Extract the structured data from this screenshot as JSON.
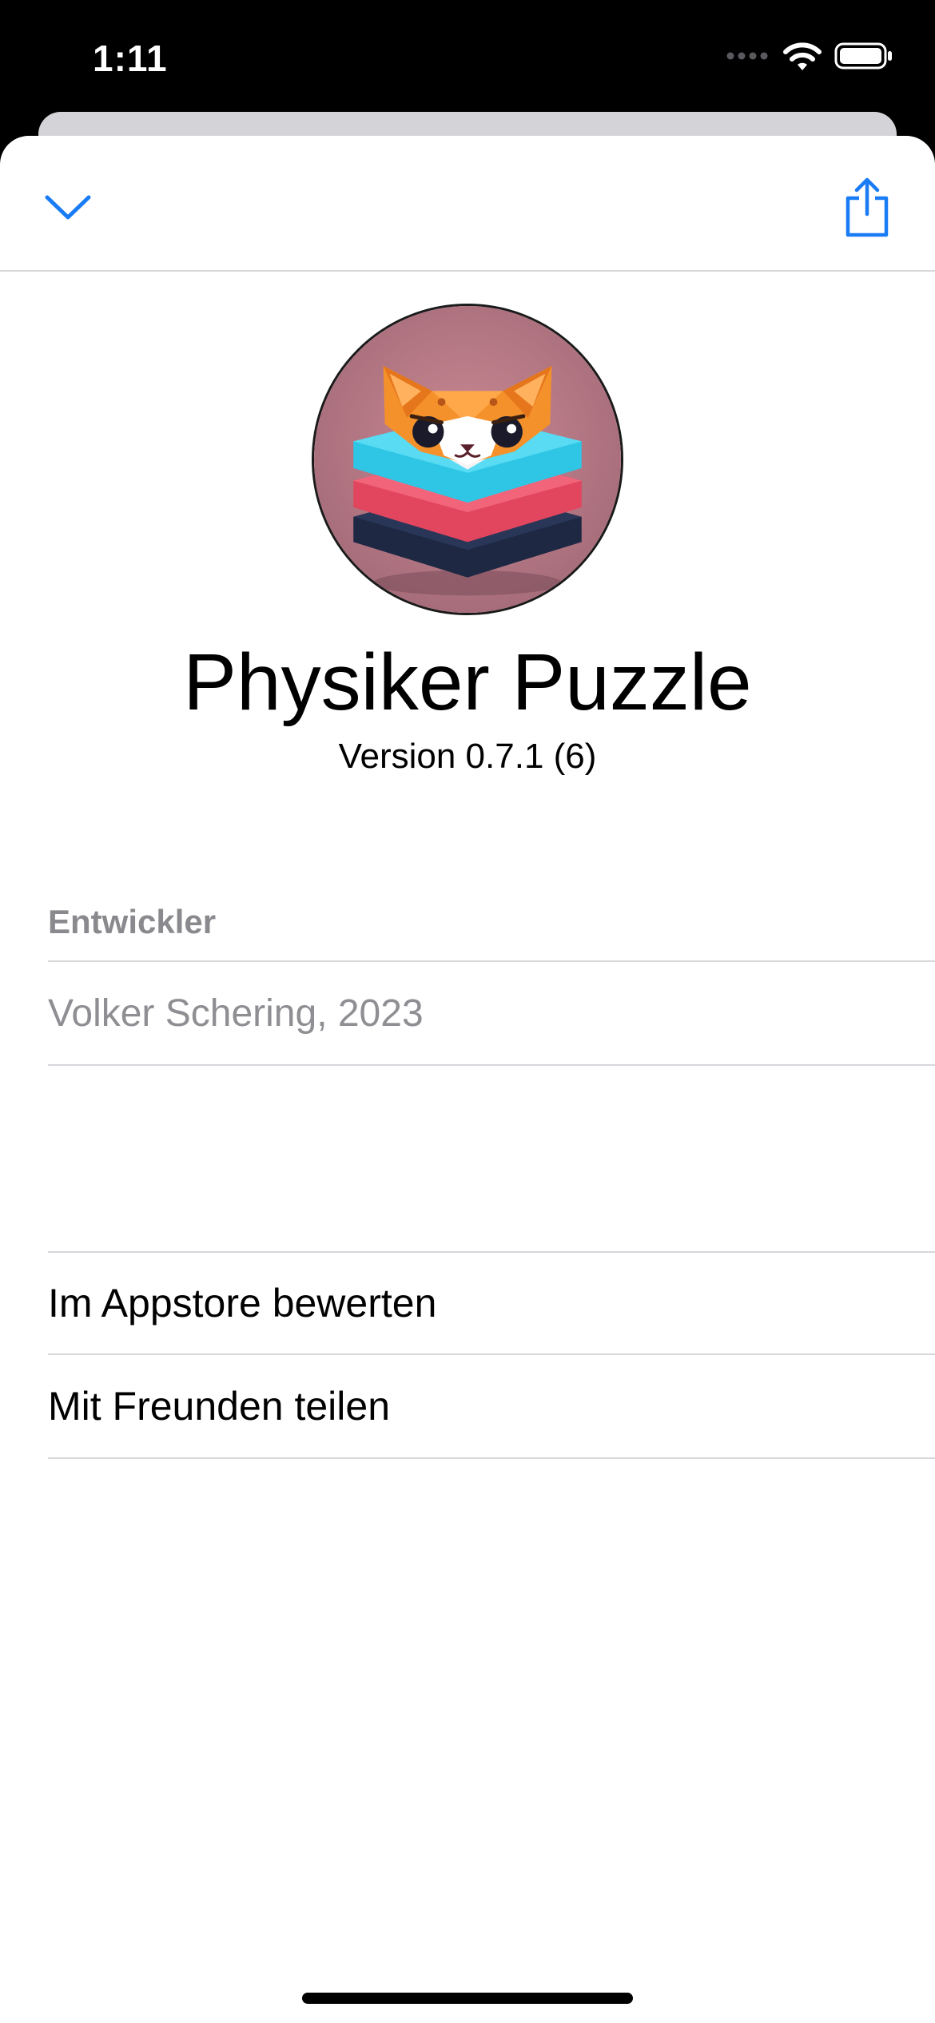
{
  "status_bar": {
    "time": "1:11"
  },
  "app": {
    "title": "Physiker Puzzle",
    "version": "Version 0.7.1 (6)",
    "icon": "fox-on-stacked-blocks-icon"
  },
  "developer_section": {
    "header": "Entwickler",
    "value": "Volker Schering, 2023"
  },
  "actions": {
    "rate_label": "Im Appstore bewerten",
    "share_label": "Mit Freunden teilen"
  },
  "colors": {
    "accent": "#1a7cf5",
    "secondary_text": "#8e8e93",
    "separator": "#d8d8dc"
  }
}
